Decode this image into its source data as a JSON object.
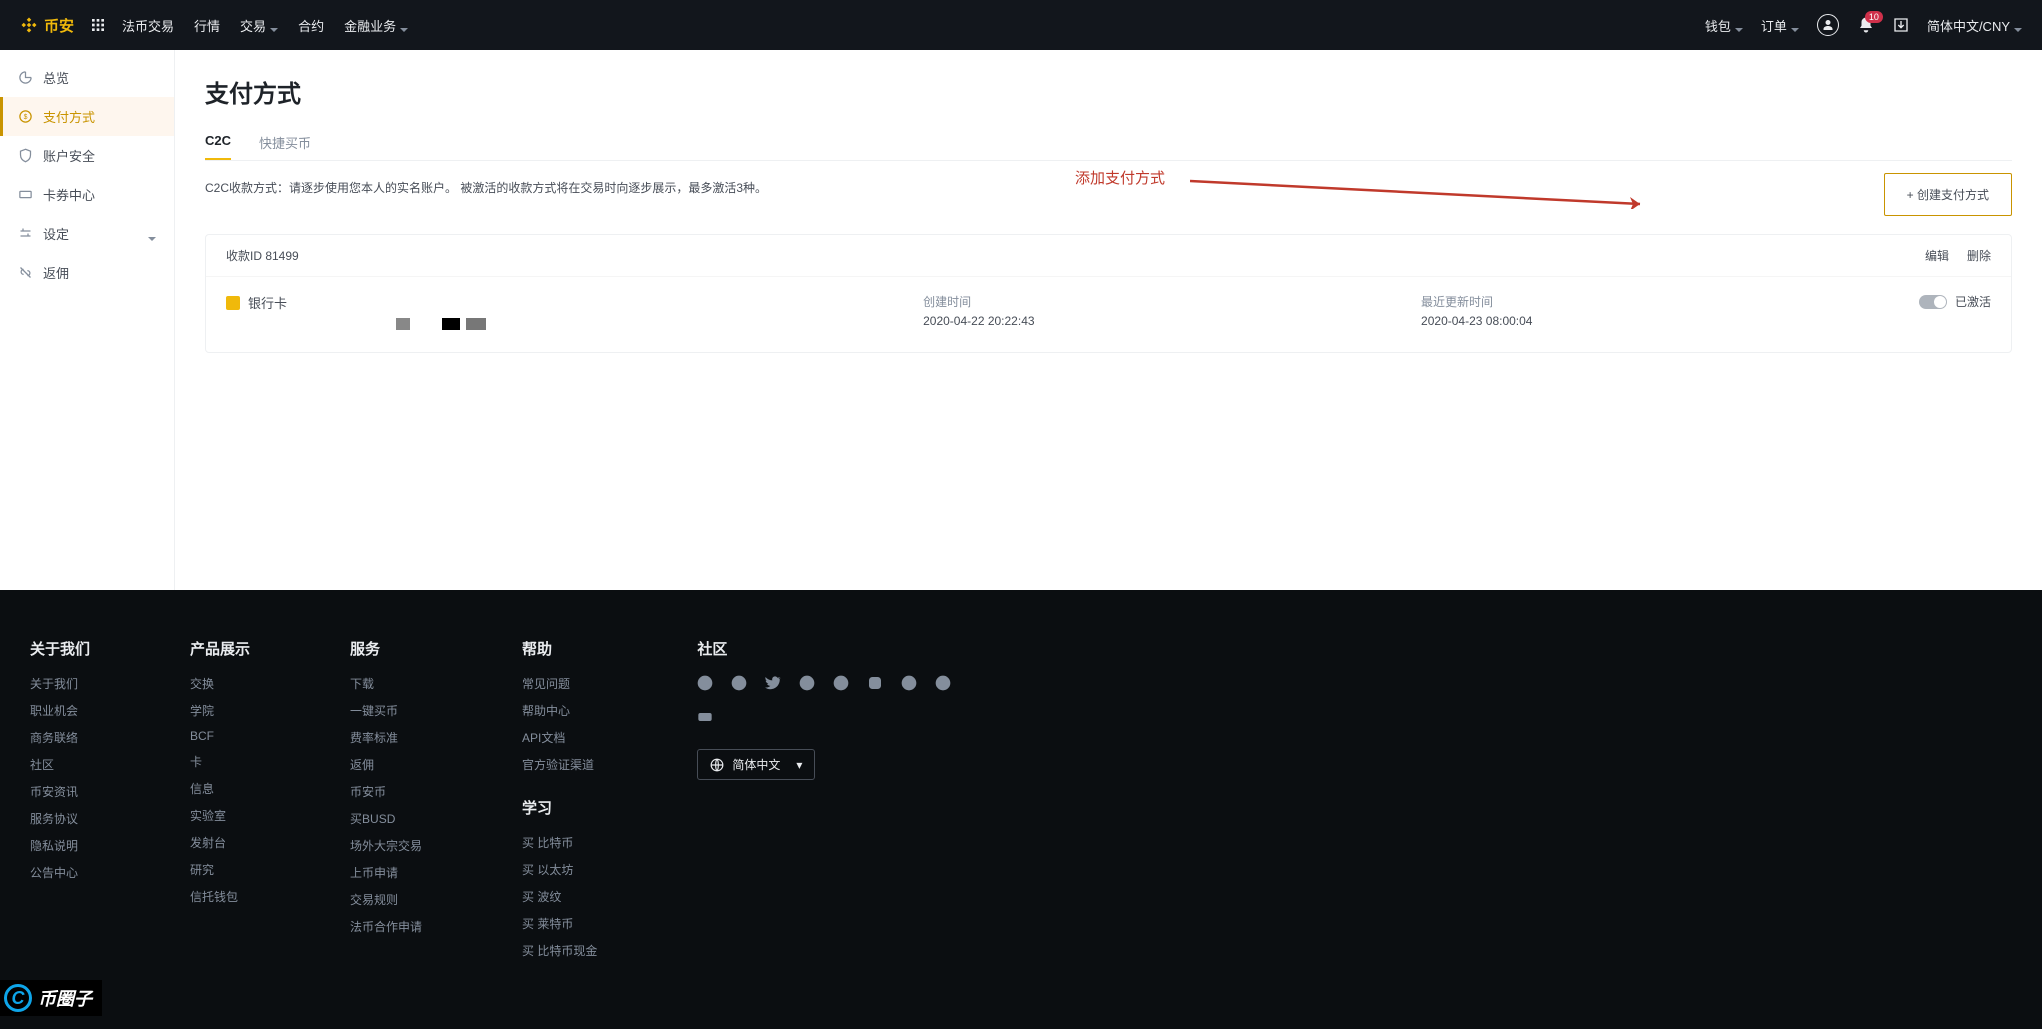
{
  "brand": "币安",
  "nav": {
    "items": [
      "法币交易",
      "行情",
      "交易",
      "合约",
      "金融业务"
    ],
    "dropdowns": [
      false,
      false,
      true,
      false,
      true
    ]
  },
  "navRight": {
    "wallet": "钱包",
    "orders": "订单",
    "badge": "10",
    "language": "简体中文/CNY"
  },
  "sidebar": {
    "items": [
      {
        "label": "总览",
        "icon": "dashboard"
      },
      {
        "label": "支付方式",
        "icon": "payment",
        "active": true
      },
      {
        "label": "账户安全",
        "icon": "shield"
      },
      {
        "label": "卡券中心",
        "icon": "ticket"
      },
      {
        "label": "设定",
        "icon": "settings",
        "caret": true
      },
      {
        "label": "返佣",
        "icon": "rebate"
      }
    ]
  },
  "page": {
    "title": "支付方式",
    "tabs": [
      "C2C",
      "快捷买币"
    ],
    "activeTab": 0,
    "desc": "C2C收款方式：请逐步使用您本人的实名账户。 被激活的收款方式将在交易时向逐步展示，最多激活3种。",
    "addBtn": "+ 创建支付方式",
    "annotation": "添加支付方式"
  },
  "paymentCard": {
    "idLabel": "收款ID 81499",
    "edit": "编辑",
    "delete": "删除",
    "type": "银行卡",
    "createdLabel": "创建时间",
    "createdValue": "2020-04-22 20:22:43",
    "updatedLabel": "最近更新时间",
    "updatedValue": "2020-04-23 08:00:04",
    "status": "已激活"
  },
  "footer": {
    "cols": [
      {
        "title": "关于我们",
        "links": [
          "关于我们",
          "职业机会",
          "商务联络",
          "社区",
          "币安资讯",
          "服务协议",
          "隐私说明",
          "公告中心"
        ]
      },
      {
        "title": "产品展示",
        "links": [
          "交换",
          "学院",
          "BCF",
          "卡",
          "信息",
          "实验室",
          "发射台",
          "研究",
          "信托钱包"
        ]
      },
      {
        "title": "服务",
        "links": [
          "下载",
          "一键买币",
          "费率标准",
          "返佣",
          "币安币",
          "买BUSD",
          "场外大宗交易",
          "上币申请",
          "交易规则",
          "法币合作申请"
        ]
      },
      {
        "title": "帮助",
        "links": [
          "常见问题",
          "帮助中心",
          "API文档",
          "官方验证渠道"
        ],
        "sub": {
          "title": "学习",
          "links": [
            "买 比特币",
            "买 以太坊",
            "买 波纹",
            "买 莱特币",
            "买 比特币现金"
          ]
        }
      }
    ],
    "communityTitle": "社区",
    "langLabel": "简体中文"
  },
  "watermark": "币圈子"
}
